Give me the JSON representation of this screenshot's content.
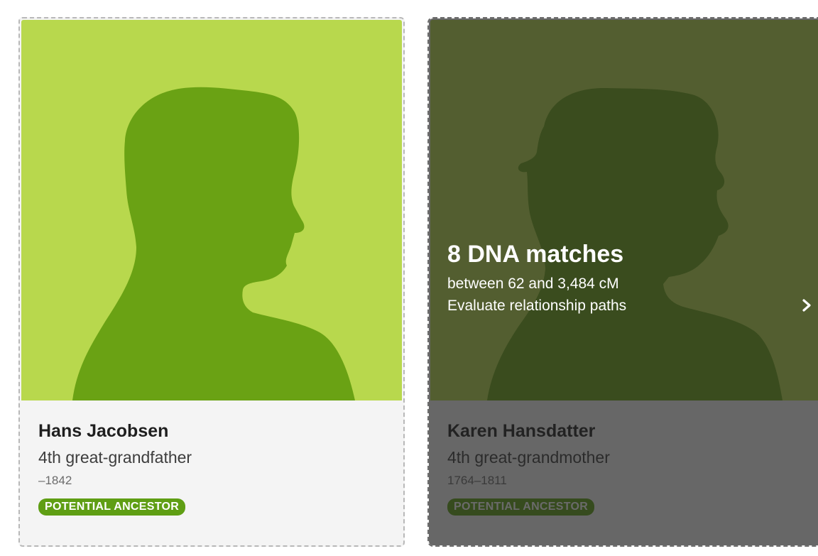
{
  "cards": [
    {
      "name": "Hans Jacobsen",
      "relationship": "4th great-grandfather",
      "years": "–1842",
      "badge": "POTENTIAL ANCESTOR",
      "avatar_icon": "male-silhouette-icon",
      "colors": {
        "photo_bg": "#b8d84d",
        "silhouette": "#6aa214",
        "badge_bg": "#5f9e14"
      }
    },
    {
      "name": "Karen Hansdatter",
      "relationship": "4th great-grandmother",
      "years": "1764–1811",
      "badge": "POTENTIAL ANCESTOR",
      "avatar_icon": "female-silhouette-icon",
      "hover_overlay": {
        "headline": "8 DNA matches",
        "range": "between 62 and 3,484 cM",
        "cta": "Evaluate relationship paths",
        "cta_icon": "chevron-right-icon"
      },
      "colors": {
        "photo_bg": "#b8d84d",
        "silhouette": "#6aa214",
        "overlay": "#232323"
      }
    }
  ]
}
